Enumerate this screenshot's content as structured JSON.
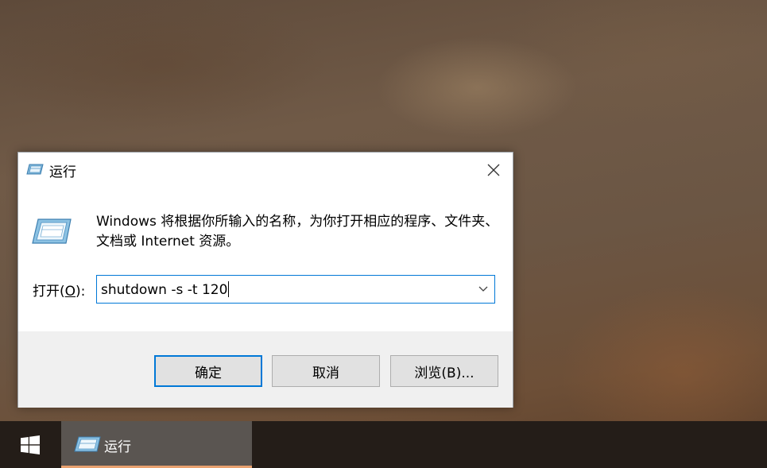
{
  "dialog": {
    "title": "运行",
    "title_icon": "run-icon",
    "close_icon": "close-icon",
    "description": "Windows 将根据你所输入的名称，为你打开相应的程序、文件夹、文档或 Internet 资源。",
    "open_label_prefix": "打开(",
    "open_label_accel": "O",
    "open_label_suffix": "):",
    "command_value": "shutdown -s -t 120",
    "dropdown_icon": "chevron-down-icon",
    "buttons": {
      "ok": "确定",
      "cancel": "取消",
      "browse": "浏览(B)..."
    }
  },
  "taskbar": {
    "start_icon": "windows-logo-icon",
    "items": [
      {
        "label": "运行",
        "icon": "run-icon",
        "active": true
      }
    ],
    "accent_color": "#e8a16f"
  },
  "colors": {
    "focus_border": "#0078d7",
    "button_face": "#e1e1e1",
    "taskbar_bg": "#241d18"
  }
}
